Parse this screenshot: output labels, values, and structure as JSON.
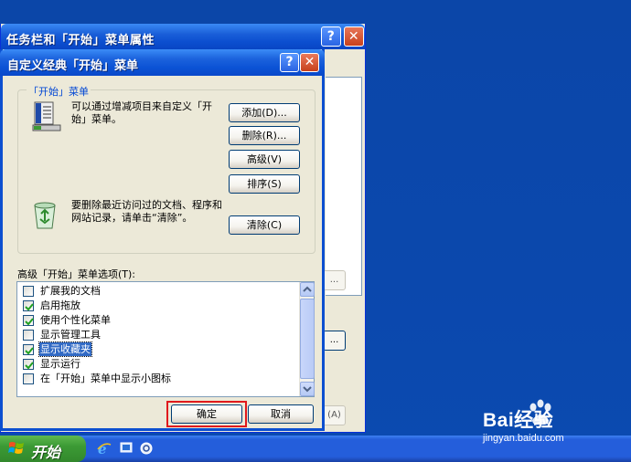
{
  "background_window": {
    "title": "任务栏和「开始」菜单属性",
    "help_glyph": "?",
    "close_glyph": "✕",
    "partial_button_1": "...",
    "partial_button_2": "...",
    "partial_button_3": "(A)"
  },
  "dialog": {
    "title": "自定义经典「开始」菜单",
    "help_glyph": "?",
    "close_glyph": "✕",
    "group_label": "「开始」菜单",
    "customize_text": "可以通过增减项目来自定义「开始」菜单。",
    "clear_text": "要删除最近访问过的文档、程序和网站记录，请单击“清除”。",
    "buttons": {
      "add": "添加(D)...",
      "remove": "删除(R)...",
      "advanced": "高级(V)",
      "sort": "排序(S)",
      "clear": "清除(C)"
    },
    "options_label": "高级「开始」菜单选项(T):",
    "options": [
      {
        "label": "扩展我的文档",
        "checked": false,
        "selected": false
      },
      {
        "label": "启用拖放",
        "checked": true,
        "selected": false
      },
      {
        "label": "使用个性化菜单",
        "checked": true,
        "selected": false
      },
      {
        "label": "显示管理工具",
        "checked": false,
        "selected": false
      },
      {
        "label": "显示收藏夹",
        "checked": true,
        "selected": true
      },
      {
        "label": "显示运行",
        "checked": true,
        "selected": false
      },
      {
        "label": "在「开始」菜单中显示小图标",
        "checked": false,
        "selected": false
      }
    ],
    "ok": "确定",
    "cancel": "取消"
  },
  "taskbar": {
    "start_label": "开始",
    "quick_launch": [
      "ie-icon",
      "desktop-icon",
      "media-icon"
    ]
  },
  "watermark": {
    "brand": "Bai经验",
    "url": "jingyan.baidu.com"
  },
  "colors": {
    "desktop": "#0b46a8",
    "titlebar": "#0c4fd0",
    "highlight": "#e0191c",
    "selection": "#316ac5"
  }
}
